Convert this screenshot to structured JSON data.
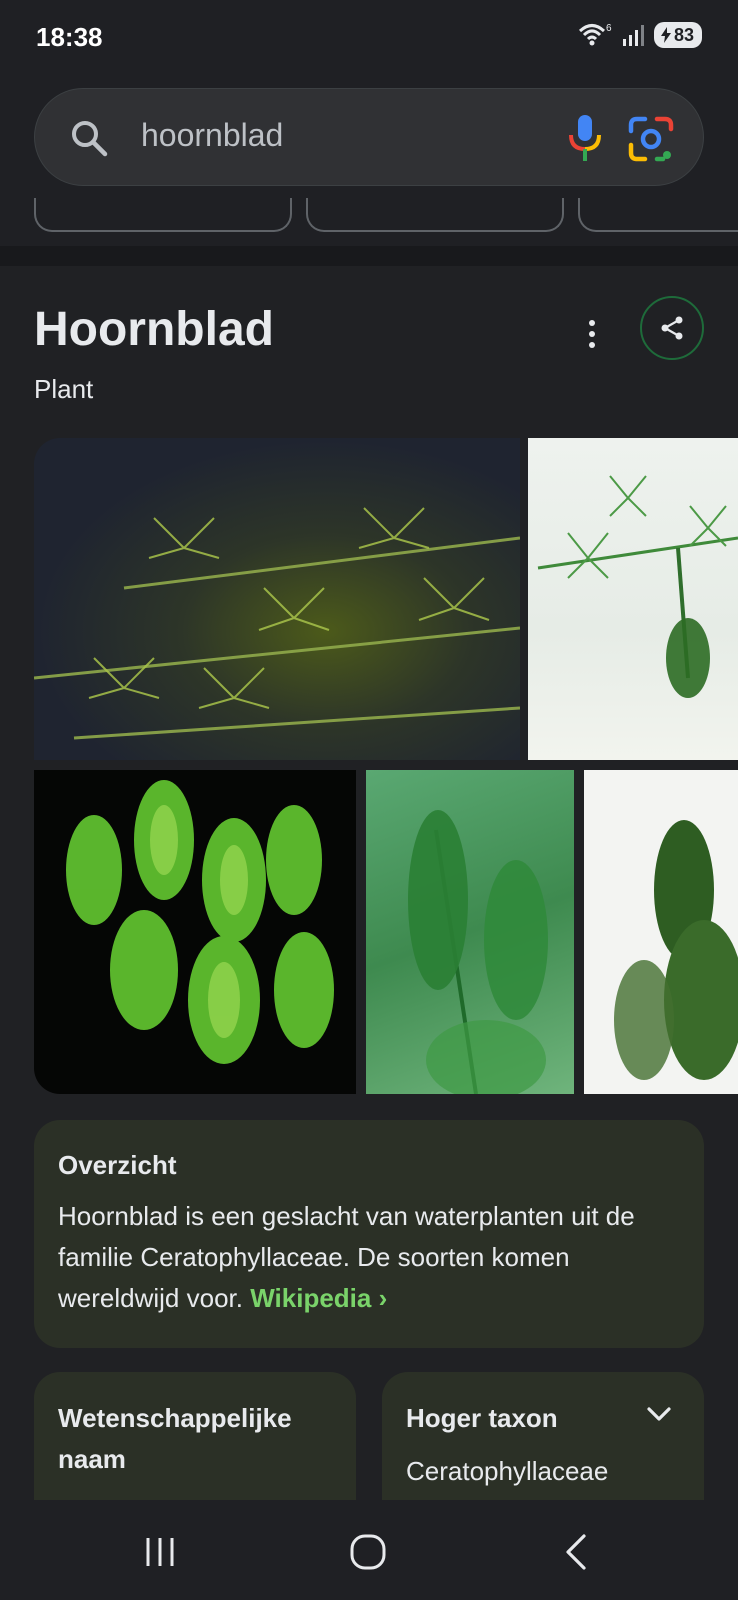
{
  "status_bar": {
    "time": "18:38",
    "battery": "83",
    "icons": [
      "wifi-6-icon",
      "signal-icon",
      "battery-charging-icon"
    ]
  },
  "search": {
    "query": "hoornblad",
    "icons": [
      "search-icon",
      "mic-icon",
      "lens-icon"
    ]
  },
  "knowledge_panel": {
    "title": "Hoornblad",
    "subtitle": "Plant",
    "actions": [
      "more-options-icon",
      "share-icon"
    ],
    "overview": {
      "heading": "Overzicht",
      "text": "Hoornblad is een geslacht van waterplanten uit de familie Ceratophyllaceae. De soorten komen wereldwijd voor.",
      "link_label": "Wikipedia",
      "link_chevron": "›"
    },
    "facts": [
      {
        "label": "Wetenschappelijke naam",
        "value": ""
      },
      {
        "label": "Hoger taxon",
        "value": "Ceratophyllaceae"
      }
    ]
  },
  "colors": {
    "background": "#202124",
    "card": "#2b3026",
    "link": "#7ad36a",
    "share_border": "#1e6b3a"
  }
}
